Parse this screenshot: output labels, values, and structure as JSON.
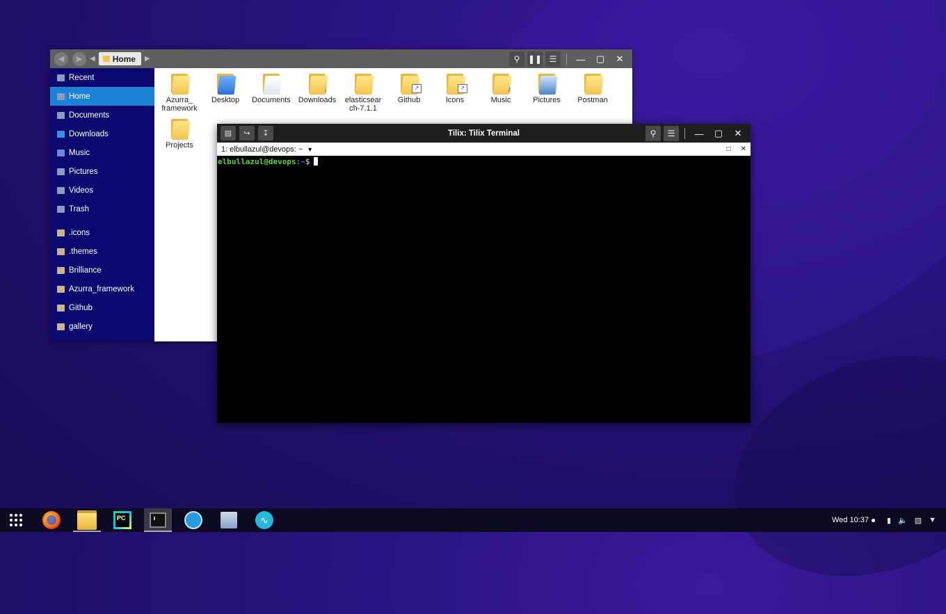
{
  "file_manager": {
    "breadcrumb": "Home",
    "sidebar": [
      {
        "label": "Recent",
        "icon": "clock-icon"
      },
      {
        "label": "Home",
        "icon": "home-icon",
        "active": true
      },
      {
        "label": "Documents",
        "icon": "documents-icon"
      },
      {
        "label": "Downloads",
        "icon": "download-icon"
      },
      {
        "label": "Music",
        "icon": "music-icon"
      },
      {
        "label": "Pictures",
        "icon": "pictures-icon"
      },
      {
        "label": "Videos",
        "icon": "videos-icon"
      },
      {
        "label": "Trash",
        "icon": "trash-icon"
      },
      {
        "label": ".icons",
        "icon": "folder-icon"
      },
      {
        "label": ".themes",
        "icon": "folder-icon"
      },
      {
        "label": "Brilliance",
        "icon": "folder-icon"
      },
      {
        "label": "Azurra_framework",
        "icon": "folder-icon"
      },
      {
        "label": "Github",
        "icon": "folder-icon"
      },
      {
        "label": "gallery",
        "icon": "folder-icon"
      }
    ],
    "files": [
      {
        "label1": "Azurra_",
        "label2": "framework"
      },
      {
        "label1": "Desktop",
        "label2": ""
      },
      {
        "label1": "Documents",
        "label2": ""
      },
      {
        "label1": "Downloads",
        "label2": ""
      },
      {
        "label1": "elasticsear",
        "label2": "ch-7.1.1"
      },
      {
        "label1": "Github",
        "label2": ""
      },
      {
        "label1": "Icons",
        "label2": ""
      },
      {
        "label1": "Music",
        "label2": ""
      },
      {
        "label1": "Pictures",
        "label2": ""
      },
      {
        "label1": "Postman",
        "label2": ""
      },
      {
        "label1": "Projects",
        "label2": ""
      }
    ]
  },
  "terminal": {
    "title": "Tilix: Tilix Terminal",
    "session": "1: elbullazul@devops: ~",
    "prompt_user": "elbullazul@devops",
    "prompt_path": ":~",
    "prompt_symbol": "$"
  },
  "taskbar": {
    "apps": [
      "app-grid-icon",
      "firefox-icon",
      "files-icon",
      "pycharm-icon",
      "tilix-icon",
      "blue-app-icon",
      "document-viewer-icon",
      "audio-wave-icon"
    ],
    "pycharm_label": "PC",
    "clock": "Wed 10:37"
  }
}
